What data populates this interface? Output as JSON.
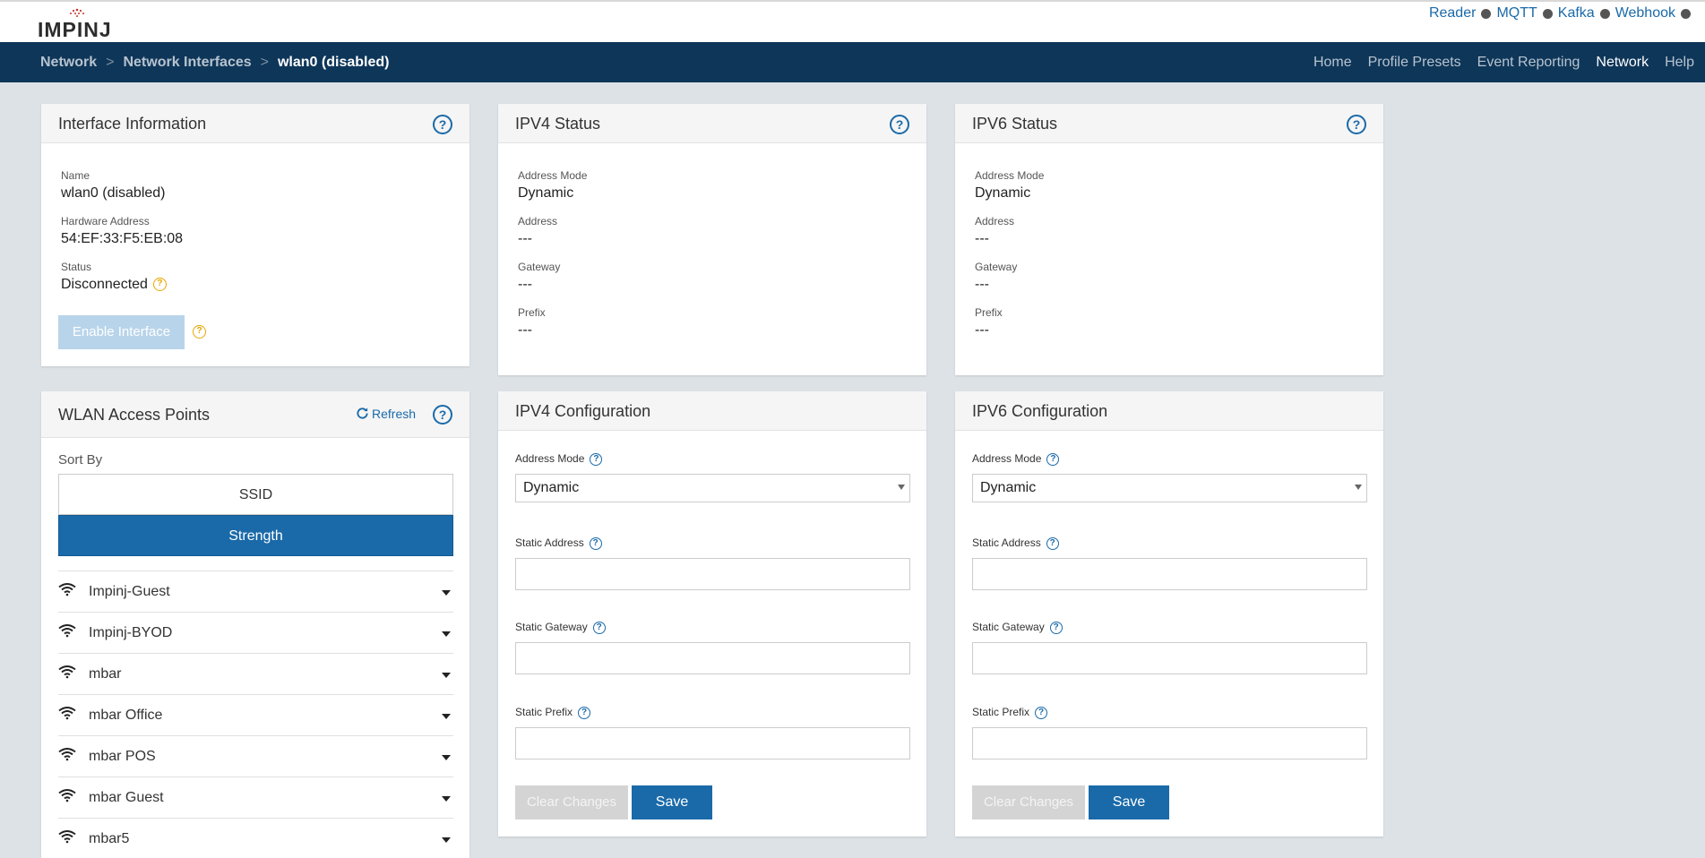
{
  "top": {
    "logo": "IMPINJ",
    "status_links": [
      "Reader",
      "MQTT",
      "Kafka",
      "Webhook"
    ]
  },
  "breadcrumb": [
    "Network",
    "Network Interfaces",
    "wlan0 (disabled)"
  ],
  "main_nav": [
    "Home",
    "Profile Presets",
    "Event Reporting",
    "Network",
    "Help"
  ],
  "interface_info": {
    "title": "Interface Information",
    "name_label": "Name",
    "name_value": "wlan0 (disabled)",
    "hw_label": "Hardware Address",
    "hw_value": "54:EF:33:F5:EB:08",
    "status_label": "Status",
    "status_value": "Disconnected",
    "enable_button": "Enable Interface"
  },
  "ipv4_status": {
    "title": "IPV4 Status",
    "mode_label": "Address Mode",
    "mode_value": "Dynamic",
    "address_label": "Address",
    "address_value": "---",
    "gateway_label": "Gateway",
    "gateway_value": "---",
    "prefix_label": "Prefix",
    "prefix_value": "---"
  },
  "ipv6_status": {
    "title": "IPV6 Status",
    "mode_label": "Address Mode",
    "mode_value": "Dynamic",
    "address_label": "Address",
    "address_value": "---",
    "gateway_label": "Gateway",
    "gateway_value": "---",
    "prefix_label": "Prefix",
    "prefix_value": "---"
  },
  "wlan": {
    "title": "WLAN Access Points",
    "refresh": "Refresh",
    "sort_by": "Sort By",
    "sort_ssid": "SSID",
    "sort_strength": "Strength",
    "networks": [
      "Impinj-Guest",
      "Impinj-BYOD",
      "mbar",
      "mbar Office",
      "mbar POS",
      "mbar Guest",
      "mbar5"
    ]
  },
  "ipv4_config": {
    "title": "IPV4 Configuration",
    "mode_label": "Address Mode",
    "mode_value": "Dynamic",
    "static_address_label": "Static Address",
    "static_gateway_label": "Static Gateway",
    "static_prefix_label": "Static Prefix",
    "clear_button": "Clear Changes",
    "save_button": "Save"
  },
  "ipv6_config": {
    "title": "IPV6 Configuration",
    "mode_label": "Address Mode",
    "mode_value": "Dynamic",
    "static_address_label": "Static Address",
    "static_gateway_label": "Static Gateway",
    "static_prefix_label": "Static Prefix",
    "clear_button": "Clear Changes",
    "save_button": "Save"
  },
  "colors": {
    "navbar": "#0e3659",
    "accent": "#1a6aa9",
    "warning": "#e8a500",
    "background": "#dde2e6"
  }
}
